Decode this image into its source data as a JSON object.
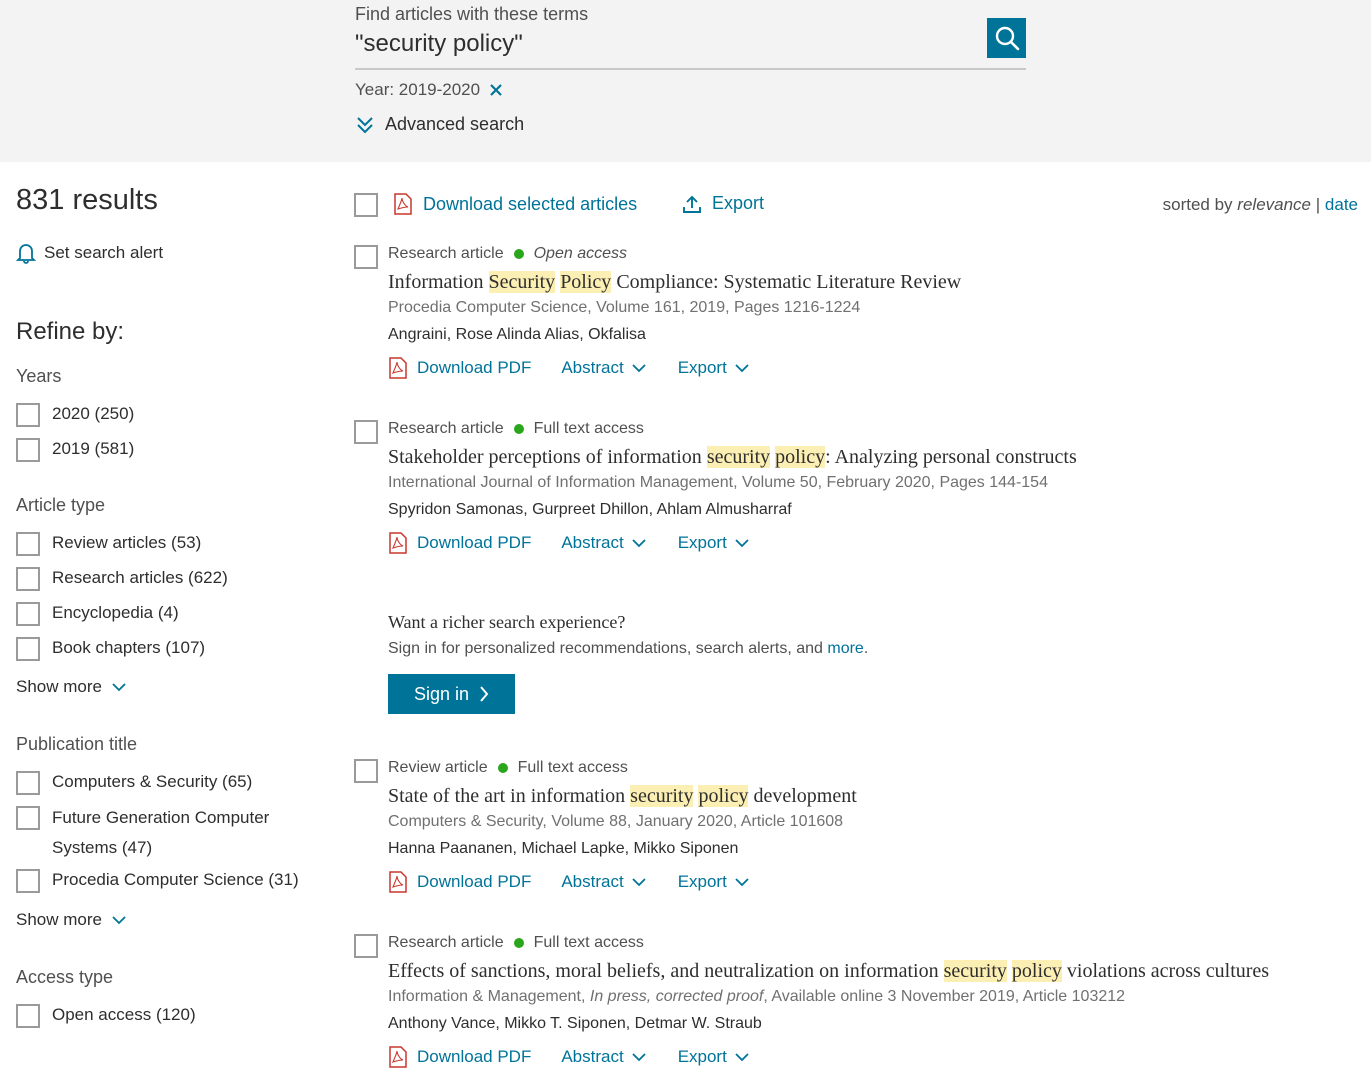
{
  "search": {
    "label": "Find articles with these terms",
    "query": "\"security policy\"",
    "filter_chip": "Year: 2019-2020",
    "advanced_label": "Advanced search"
  },
  "sidebar": {
    "results_count": "831 results",
    "alert_label": "Set search alert",
    "refine_label": "Refine by:",
    "years": {
      "title": "Years",
      "items": [
        {
          "label": "2020 (250)"
        },
        {
          "label": "2019 (581)"
        }
      ]
    },
    "article_type": {
      "title": "Article type",
      "items": [
        {
          "label": "Review articles (53)"
        },
        {
          "label": "Research articles (622)"
        },
        {
          "label": "Encyclopedia (4)"
        },
        {
          "label": "Book chapters (107)"
        }
      ],
      "show_more": "Show more"
    },
    "publication_title": {
      "title": "Publication title",
      "items": [
        {
          "label": "Computers & Security (65)"
        },
        {
          "label": "Future Generation Computer Systems (47)"
        },
        {
          "label": "Procedia Computer Science (31)"
        }
      ],
      "show_more": "Show more"
    },
    "access_type": {
      "title": "Access type",
      "items": [
        {
          "label": "Open access (120)"
        }
      ]
    }
  },
  "toolbar": {
    "download_label": "Download selected articles",
    "export_label": "Export",
    "sorted_prefix": "sorted by",
    "sorted_relevance": "relevance",
    "sorted_sep": "|",
    "sorted_date": "date"
  },
  "results": [
    {
      "type": "Research article",
      "access": "Open access",
      "title_parts": [
        "Information ",
        "Security",
        " ",
        "Policy",
        " Compliance: Systematic Literature Review"
      ],
      "source": "Procedia Computer Science, Volume 161, 2019, Pages 1216-1224",
      "authors": "Angraini, Rose Alinda Alias, Okfalisa",
      "pdf_label": "Download PDF",
      "abstract_label": "Abstract",
      "export_label": "Export"
    },
    {
      "type": "Research article",
      "access": "Full text access",
      "title_parts": [
        "Stakeholder perceptions of information ",
        "security",
        " ",
        "policy",
        ": Analyzing personal constructs"
      ],
      "source": "International Journal of Information Management, Volume 50, February 2020, Pages 144-154",
      "authors": "Spyridon Samonas, Gurpreet Dhillon, Ahlam Almusharraf",
      "pdf_label": "Download PDF",
      "abstract_label": "Abstract",
      "export_label": "Export"
    },
    {
      "type": "Review article",
      "access": "Full text access",
      "title_parts": [
        "State of the art in information ",
        "security",
        " ",
        "policy",
        " development"
      ],
      "source": "Computers & Security, Volume 88, January 2020, Article 101608",
      "authors": "Hanna Paananen, Michael Lapke, Mikko Siponen",
      "pdf_label": "Download PDF",
      "abstract_label": "Abstract",
      "export_label": "Export"
    },
    {
      "type": "Research article",
      "access": "Full text access",
      "title_parts": [
        "Effects of sanctions, moral beliefs, and neutralization on information ",
        "security",
        " ",
        "policy",
        " violations across cultures"
      ],
      "source_parts": [
        "Information & Management, ",
        "In press, corrected proof",
        ", Available online 3 November 2019, Article 103212"
      ],
      "authors": "Anthony Vance, Mikko T. Siponen, Detmar W. Straub",
      "pdf_label": "Download PDF",
      "abstract_label": "Abstract",
      "export_label": "Export"
    }
  ],
  "promo": {
    "title": "Want a richer search experience?",
    "text": "Sign in for personalized recommendations, search alerts, and",
    "more_link": "more",
    "period": ".",
    "button_label": "Sign in"
  },
  "colors": {
    "accent": "#007398",
    "highlight": "#fcefb4",
    "access_dot": "#29a61b",
    "header_bg": "#f3f3f3"
  }
}
